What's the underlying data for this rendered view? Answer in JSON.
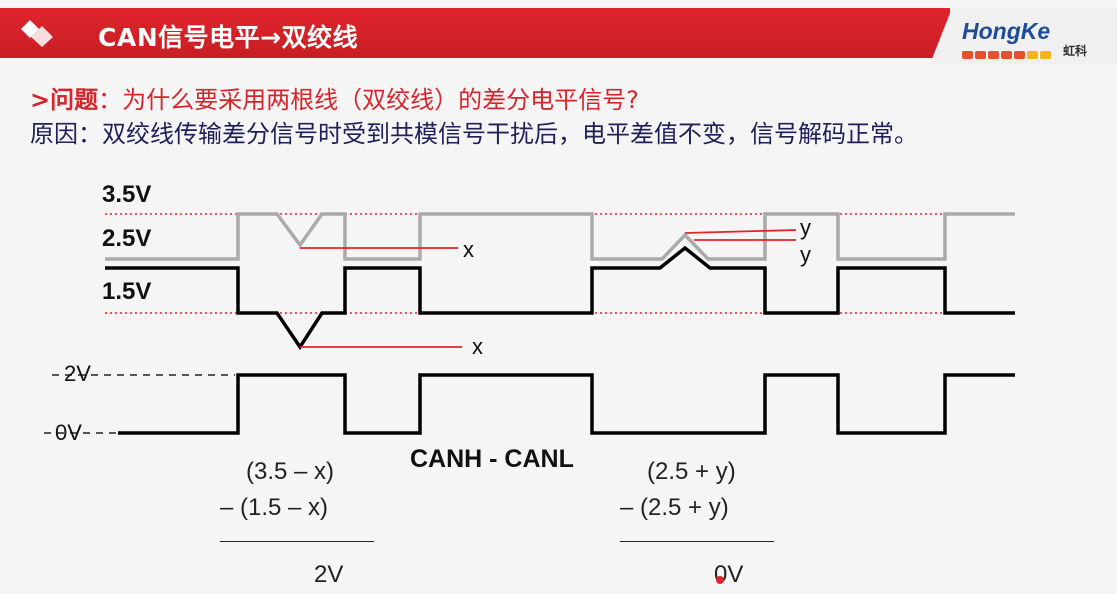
{
  "header": {
    "title": "CAN信号电平→双绞线",
    "brand_name": "HongKe",
    "brand_cn": "虹科"
  },
  "question": {
    "prefix": ">问题",
    "text": "：为什么要采用两根线（双绞线）的差分电平信号?"
  },
  "reason": {
    "text": "原因：双绞线传输差分信号时受到共模信号干扰后，电平差值不变，信号解码正常。"
  },
  "levels": {
    "v35": "3.5V",
    "v25": "2.5V",
    "v15": "1.5V",
    "v2": "2V",
    "v0": "0V"
  },
  "labels": {
    "x_upper": "x",
    "x_lower": "x",
    "y_upper": "y",
    "y_lower": "y",
    "diff_title": "CANH - CANL"
  },
  "calc_left": {
    "line1": "(3.5 – x)",
    "line2": "– (1.5 – x)",
    "result": "2V"
  },
  "calc_right": {
    "line1": "(2.5 + y)",
    "line2": "– (2.5 + y)",
    "result": "0V"
  },
  "colors": {
    "brand_red": "#d4262b",
    "canh": "#aaaaaa",
    "canl": "#000000",
    "reference_line": "#e0242b"
  }
}
